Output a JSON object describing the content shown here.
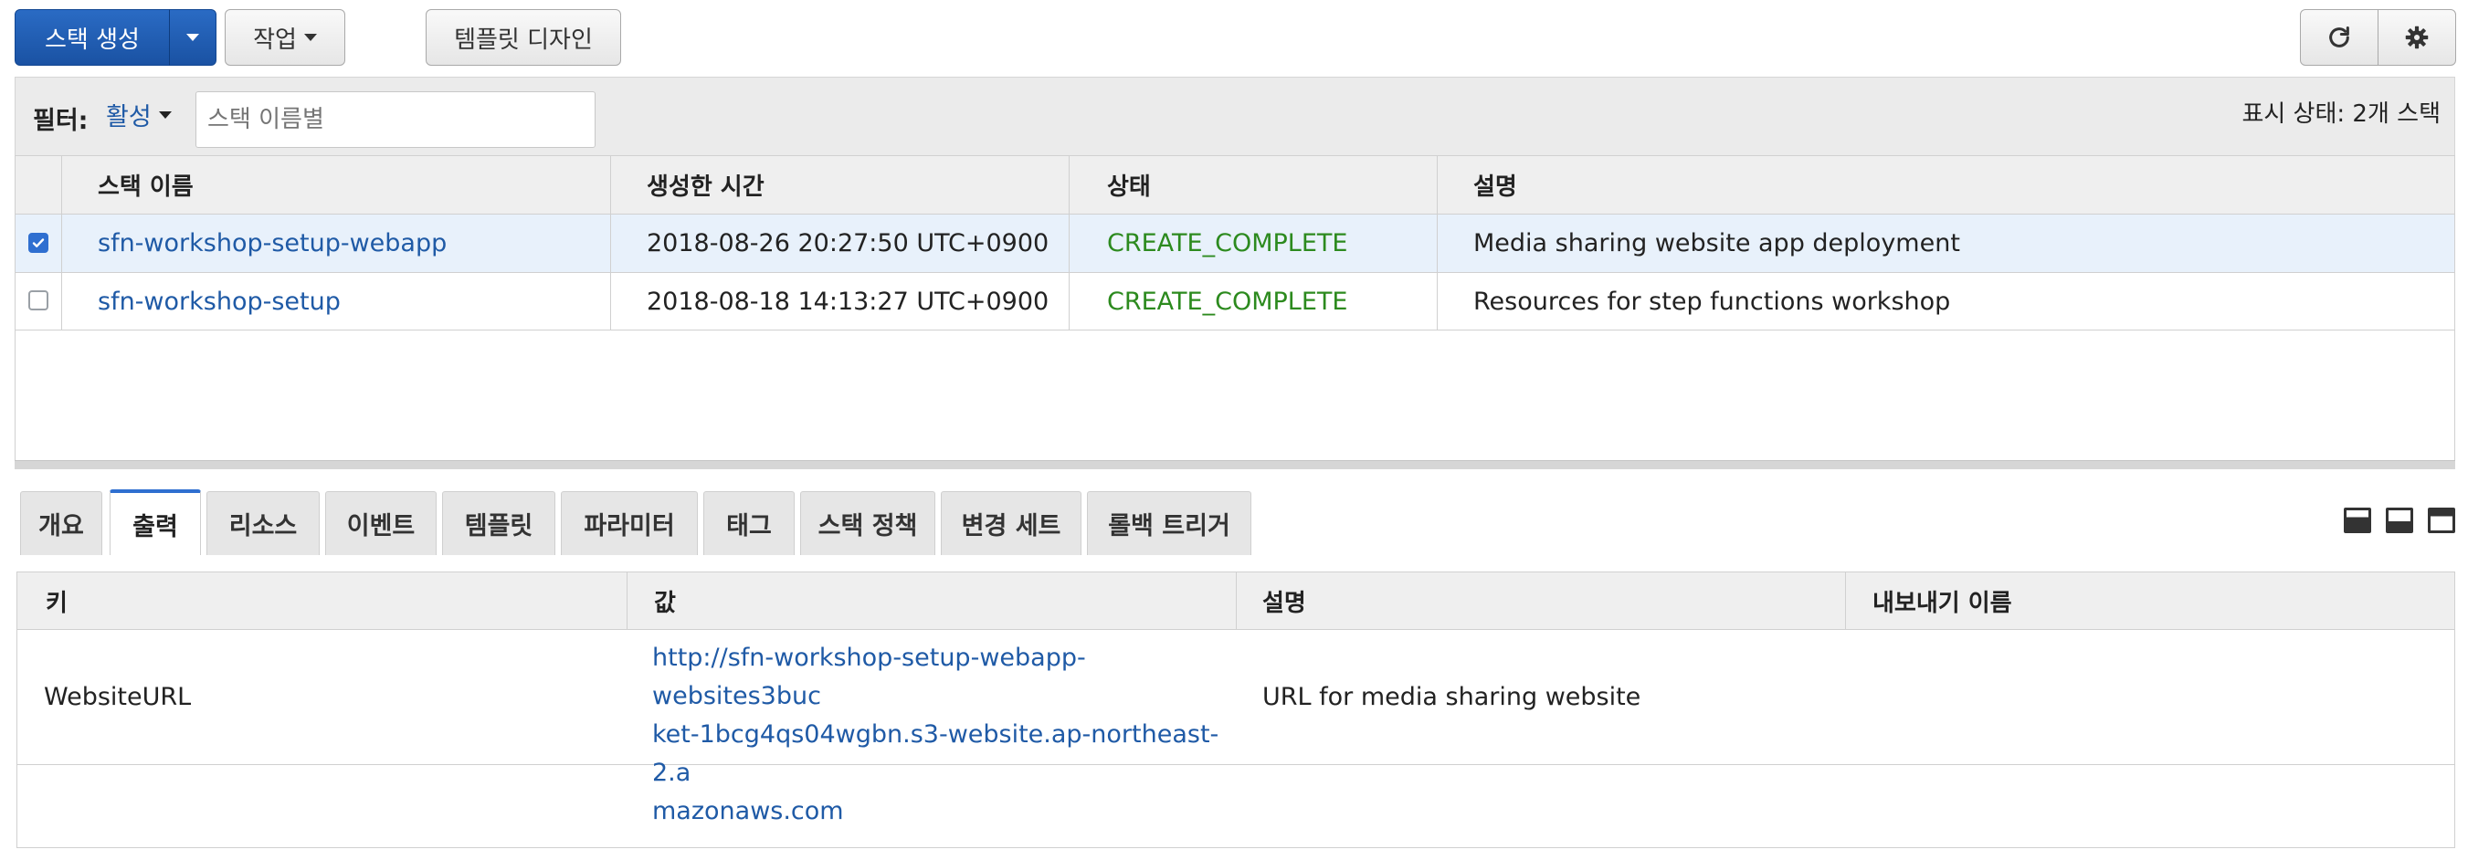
{
  "toolbar": {
    "create_stack": "스택 생성",
    "actions": "작업",
    "design_template": "템플릿 디자인",
    "refresh_icon": "refresh-icon",
    "settings_icon": "gear-icon"
  },
  "filter": {
    "label": "필터:",
    "status": "활성",
    "search_placeholder": "스택 이름별",
    "summary": "표시 상태: 2개 스택"
  },
  "stacks": {
    "columns": [
      "스택 이름",
      "생성한 시간",
      "상태",
      "설명"
    ],
    "rows": [
      {
        "selected": true,
        "name": "sfn-workshop-setup-webapp",
        "created": "2018-08-26 20:27:50 UTC+0900",
        "status": "CREATE_COMPLETE",
        "description": "Media sharing website app deployment"
      },
      {
        "selected": false,
        "name": "sfn-workshop-setup",
        "created": "2018-08-18 14:13:27 UTC+0900",
        "status": "CREATE_COMPLETE",
        "description": "Resources for step functions workshop"
      }
    ]
  },
  "tabs": [
    {
      "label": "개요"
    },
    {
      "label": "출력"
    },
    {
      "label": "리소스"
    },
    {
      "label": "이벤트"
    },
    {
      "label": "템플릿"
    },
    {
      "label": "파라미터"
    },
    {
      "label": "태그"
    },
    {
      "label": "스택 정책"
    },
    {
      "label": "변경 세트"
    },
    {
      "label": "롤백 트리거"
    }
  ],
  "active_tab": "출력",
  "outputs": {
    "columns": [
      "키",
      "값",
      "설명",
      "내보내기 이름"
    ],
    "rows": [
      {
        "key": "WebsiteURL",
        "value_lines": [
          "http://sfn-workshop-setup-webapp-websites3buc",
          "ket-1bcg4qs04wgbn.s3-website.ap-northeast-2.a",
          "mazonaws.com"
        ],
        "description": "URL for media sharing website",
        "export_name": ""
      }
    ]
  },
  "colors": {
    "primary": "#1a52a3",
    "link": "#1f5aa6",
    "status_complete": "#2c8a1e",
    "selected_row": "#e8f1fb"
  }
}
